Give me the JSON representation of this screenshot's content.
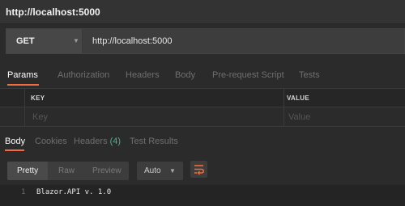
{
  "window": {
    "title": "http://localhost:5000"
  },
  "request": {
    "method": "GET",
    "url": "http://localhost:5000",
    "tabs": [
      "Params",
      "Authorization",
      "Headers",
      "Body",
      "Pre-request Script",
      "Tests"
    ],
    "active_tab": "Params",
    "params": {
      "key_header": "KEY",
      "value_header": "VALUE",
      "key_placeholder": "Key",
      "value_placeholder": "Value"
    }
  },
  "response": {
    "tabs": {
      "body": "Body",
      "cookies": "Cookies",
      "headers": "Headers",
      "headers_count": "(4)",
      "test_results": "Test Results"
    },
    "format_options": [
      "Pretty",
      "Raw",
      "Preview"
    ],
    "format_selected": "Pretty",
    "language": "Auto",
    "lines": [
      {
        "number": "1",
        "text": "Blazor.API v. 1.0"
      }
    ]
  },
  "colors": {
    "accent": "#f26b3a",
    "count": "#3fb59a",
    "background": "#2b2b2b"
  }
}
